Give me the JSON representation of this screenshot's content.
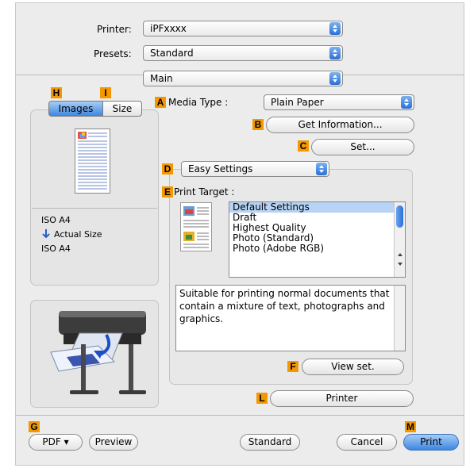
{
  "printer": {
    "label": "Printer:",
    "value": "iPFxxxx"
  },
  "presets": {
    "label": "Presets:",
    "value": "Standard"
  },
  "panel_select": {
    "value": "Main"
  },
  "tabs": {
    "images": "Images",
    "size": "Size"
  },
  "markers": {
    "A": "A",
    "B": "B",
    "C": "C",
    "D": "D",
    "E": "E",
    "F": "F",
    "G": "G",
    "H": "H",
    "I": "I",
    "L": "L",
    "M": "M"
  },
  "media_type": {
    "label": "Media Type :",
    "value": "Plain Paper"
  },
  "buttons": {
    "get_information": "Get Information...",
    "set": "Set...",
    "view_set": "View set.",
    "printer": "Printer",
    "pdf": "PDF ▾",
    "preview": "Preview",
    "standard": "Standard",
    "cancel": "Cancel",
    "print": "Print"
  },
  "easy_settings": {
    "value": "Easy Settings"
  },
  "print_target": {
    "label": "Print Target :",
    "items": [
      "Default Settings",
      "Draft",
      "Highest Quality",
      "Photo (Standard)",
      "Photo (Adobe RGB)"
    ],
    "selected_index": 0
  },
  "description": "Suitable for printing normal documents that contain a mixture of text, photographs and graphics.",
  "paper_info": {
    "source_size": "ISO A4",
    "scaling": "Actual Size",
    "output_size": "ISO A4"
  },
  "colors": {
    "accent_blue": "#3d86e0",
    "marker_orange": "#f39800"
  }
}
